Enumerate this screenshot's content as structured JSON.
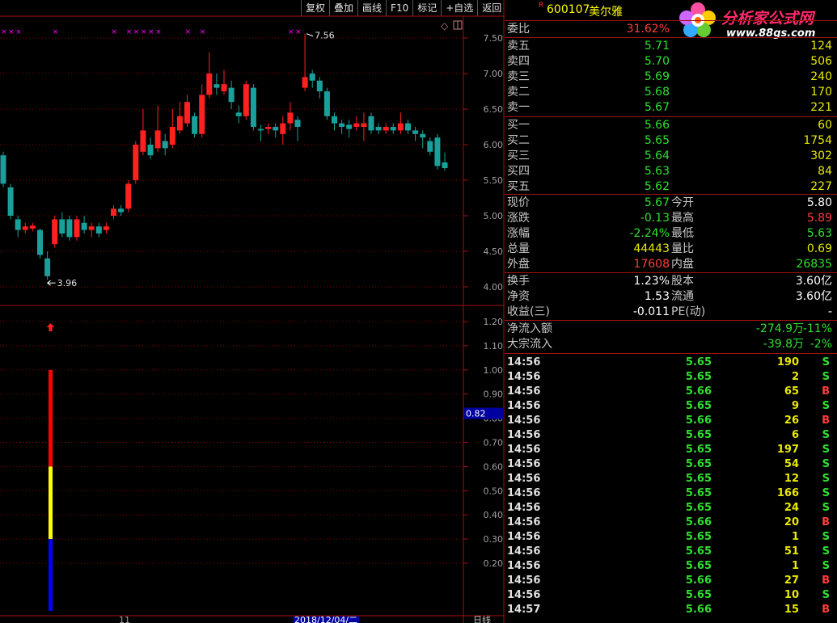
{
  "toolbar": {
    "buttons": [
      "复权",
      "叠加",
      "画线",
      "F10",
      "标记",
      "+自选",
      "返回"
    ]
  },
  "stock": {
    "marker": "R",
    "code": "600107",
    "name": "美尔雅"
  },
  "logo": {
    "text": "分析家公式网",
    "url": "www.88gs.com"
  },
  "colors": {
    "up": "#ff2020",
    "down": "#1aa09a",
    "bg": "#000000",
    "grid": "#8b0000",
    "mark": "#ff00ff"
  },
  "price_axis": [
    "7.50",
    "7.00",
    "6.50",
    "6.00",
    "5.50",
    "5.00",
    "4.50",
    "4.00"
  ],
  "price_annotations": {
    "high": "7.56",
    "low": "3.96"
  },
  "indicator_axis": [
    "1.20",
    "1.10",
    "1.00",
    "0.90",
    "0.80",
    "0.70",
    "0.60",
    "0.50",
    "0.40",
    "0.30",
    "0.20"
  ],
  "indicator_current": "0.82",
  "indicator_bar": {
    "red_top": 1.0,
    "red_bottom": 0.6,
    "yellow_bottom": 0.3,
    "blue_bottom": 0.0
  },
  "date_label": "2018/12/04/二",
  "date_tick": "11",
  "period_label": "日线",
  "chart_data": {
    "type": "candlestick",
    "candles": [
      [
        5.85,
        5.45,
        5.9,
        5.4
      ],
      [
        5.4,
        5.0,
        5.45,
        4.95
      ],
      [
        4.95,
        4.8,
        5.0,
        4.7
      ],
      [
        4.8,
        4.85,
        4.9,
        4.75
      ],
      [
        4.82,
        4.86,
        4.9,
        4.78
      ],
      [
        4.8,
        4.45,
        4.82,
        4.4
      ],
      [
        4.4,
        4.15,
        4.5,
        4.1
      ],
      [
        4.6,
        4.95,
        5.0,
        4.55
      ],
      [
        4.95,
        4.75,
        5.05,
        4.7
      ],
      [
        4.95,
        4.7,
        5.0,
        4.65
      ],
      [
        4.7,
        4.95,
        5.0,
        4.65
      ],
      [
        4.9,
        4.8,
        5.0,
        4.75
      ],
      [
        4.8,
        4.85,
        4.9,
        4.7
      ],
      [
        4.85,
        4.75,
        4.9,
        4.7
      ],
      [
        4.8,
        4.85,
        4.9,
        4.75
      ],
      [
        5.0,
        5.1,
        5.15,
        4.95
      ],
      [
        5.1,
        5.05,
        5.15,
        5.0
      ],
      [
        5.1,
        5.45,
        5.5,
        5.05
      ],
      [
        5.5,
        6.0,
        6.05,
        5.45
      ],
      [
        5.9,
        6.2,
        6.5,
        5.85
      ],
      [
        6.0,
        5.85,
        6.1,
        5.8
      ],
      [
        5.95,
        6.2,
        6.55,
        5.9
      ],
      [
        6.05,
        5.95,
        6.15,
        5.85
      ],
      [
        6.0,
        6.25,
        6.5,
        5.95
      ],
      [
        6.2,
        6.4,
        6.6,
        6.15
      ],
      [
        6.3,
        6.6,
        6.7,
        6.25
      ],
      [
        6.4,
        6.15,
        6.45,
        6.1
      ],
      [
        6.15,
        6.7,
        6.85,
        6.1
      ],
      [
        6.7,
        7.0,
        7.3,
        6.65
      ],
      [
        6.85,
        6.8,
        7.0,
        6.7
      ],
      [
        6.75,
        6.85,
        7.05,
        6.7
      ],
      [
        6.8,
        6.6,
        6.9,
        6.5
      ],
      [
        6.45,
        6.4,
        6.55,
        6.3
      ],
      [
        6.4,
        6.85,
        6.9,
        6.35
      ],
      [
        6.8,
        6.25,
        6.85,
        6.2
      ],
      [
        6.22,
        6.2,
        6.28,
        6.05
      ],
      [
        6.22,
        6.25,
        6.3,
        6.15
      ],
      [
        6.25,
        6.2,
        6.3,
        6.1
      ],
      [
        6.15,
        6.3,
        6.4,
        6.0
      ],
      [
        6.3,
        6.45,
        6.6,
        6.2
      ],
      [
        6.35,
        6.25,
        6.4,
        6.05
      ],
      [
        6.8,
        6.95,
        7.56,
        6.75
      ],
      [
        7.0,
        6.9,
        7.05,
        6.8
      ],
      [
        6.9,
        6.75,
        6.95,
        6.65
      ],
      [
        6.75,
        6.4,
        6.8,
        6.35
      ],
      [
        6.4,
        6.3,
        6.45,
        6.2
      ],
      [
        6.3,
        6.25,
        6.35,
        6.15
      ],
      [
        6.28,
        6.22,
        6.35,
        6.1
      ],
      [
        6.25,
        6.3,
        6.4,
        6.2
      ],
      [
        6.25,
        6.3,
        6.45,
        6.05
      ],
      [
        6.4,
        6.2,
        6.45,
        6.15
      ],
      [
        6.25,
        6.2,
        6.3,
        6.15
      ],
      [
        6.2,
        6.25,
        6.3,
        6.15
      ],
      [
        6.25,
        6.2,
        6.3,
        6.15
      ],
      [
        6.2,
        6.3,
        6.45,
        6.15
      ],
      [
        6.3,
        6.2,
        6.35,
        6.15
      ],
      [
        6.2,
        6.15,
        6.25,
        6.05
      ],
      [
        6.15,
        6.1,
        6.2,
        5.95
      ],
      [
        6.05,
        5.9,
        6.1,
        5.85
      ],
      [
        6.1,
        5.7,
        6.15,
        5.65
      ],
      [
        5.75,
        5.67,
        5.89,
        5.63
      ]
    ],
    "ylim": [
      3.85,
      7.65
    ]
  },
  "quote": {
    "weibi": {
      "label": "委比",
      "value": "31.62%",
      "extra": "124"
    },
    "sell": [
      {
        "label": "卖五",
        "price": "5.71",
        "vol": "124"
      },
      {
        "label": "卖四",
        "price": "5.70",
        "vol": "506"
      },
      {
        "label": "卖三",
        "price": "5.69",
        "vol": "240"
      },
      {
        "label": "卖二",
        "price": "5.68",
        "vol": "170"
      },
      {
        "label": "卖一",
        "price": "5.67",
        "vol": "221"
      }
    ],
    "buy": [
      {
        "label": "买一",
        "price": "5.66",
        "vol": "60"
      },
      {
        "label": "买二",
        "price": "5.65",
        "vol": "1754"
      },
      {
        "label": "买三",
        "price": "5.64",
        "vol": "302"
      },
      {
        "label": "买四",
        "price": "5.63",
        "vol": "84"
      },
      {
        "label": "买五",
        "price": "5.62",
        "vol": "227"
      }
    ],
    "stats": [
      {
        "l1": "现价",
        "v1": "5.67",
        "c1": "grn",
        "l2": "今开",
        "v2": "5.80",
        "c2": "wht"
      },
      {
        "l1": "涨跌",
        "v1": "-0.13",
        "c1": "grn",
        "l2": "最高",
        "v2": "5.89",
        "c2": "red"
      },
      {
        "l1": "涨幅",
        "v1": "-2.24%",
        "c1": "grn",
        "l2": "最低",
        "v2": "5.63",
        "c2": "grn"
      },
      {
        "l1": "总量",
        "v1": "44443",
        "c1": "yel",
        "l2": "量比",
        "v2": "0.69",
        "c2": "yel"
      },
      {
        "l1": "外盘",
        "v1": "17608",
        "c1": "red",
        "l2": "内盘",
        "v2": "26835",
        "c2": "grn"
      }
    ],
    "fund": [
      {
        "l1": "换手",
        "v1": "1.23%",
        "l2": "股本",
        "v2": "3.60亿"
      },
      {
        "l1": "净资",
        "v1": "1.53",
        "l2": "流通",
        "v2": "3.60亿"
      },
      {
        "l1": "收益(三)",
        "v1": "-0.011",
        "l2": "PE(动)",
        "v2": "-"
      }
    ],
    "flow": [
      {
        "label": "净流入额",
        "v1": "-274.9万",
        "v2": "-11%"
      },
      {
        "label": "大宗流入",
        "v1": "-39.8万",
        "v2": "-2%"
      }
    ]
  },
  "ticks": [
    {
      "t": "14:56",
      "p": "5.65",
      "v": "190",
      "s": "S"
    },
    {
      "t": "14:56",
      "p": "5.65",
      "v": "2",
      "s": "S"
    },
    {
      "t": "14:56",
      "p": "5.66",
      "v": "65",
      "s": "B"
    },
    {
      "t": "14:56",
      "p": "5.65",
      "v": "9",
      "s": "S"
    },
    {
      "t": "14:56",
      "p": "5.66",
      "v": "26",
      "s": "B"
    },
    {
      "t": "14:56",
      "p": "5.65",
      "v": "6",
      "s": "S"
    },
    {
      "t": "14:56",
      "p": "5.65",
      "v": "197",
      "s": "S"
    },
    {
      "t": "14:56",
      "p": "5.65",
      "v": "54",
      "s": "S"
    },
    {
      "t": "14:56",
      "p": "5.65",
      "v": "12",
      "s": "S"
    },
    {
      "t": "14:56",
      "p": "5.65",
      "v": "166",
      "s": "S"
    },
    {
      "t": "14:56",
      "p": "5.65",
      "v": "24",
      "s": "S"
    },
    {
      "t": "14:56",
      "p": "5.66",
      "v": "20",
      "s": "B"
    },
    {
      "t": "14:56",
      "p": "5.65",
      "v": "1",
      "s": "S"
    },
    {
      "t": "14:56",
      "p": "5.65",
      "v": "51",
      "s": "S"
    },
    {
      "t": "14:56",
      "p": "5.65",
      "v": "1",
      "s": "S"
    },
    {
      "t": "14:56",
      "p": "5.66",
      "v": "27",
      "s": "B"
    },
    {
      "t": "14:56",
      "p": "5.65",
      "v": "10",
      "s": "S"
    },
    {
      "t": "14:57",
      "p": "5.66",
      "v": "15",
      "s": "B"
    }
  ]
}
